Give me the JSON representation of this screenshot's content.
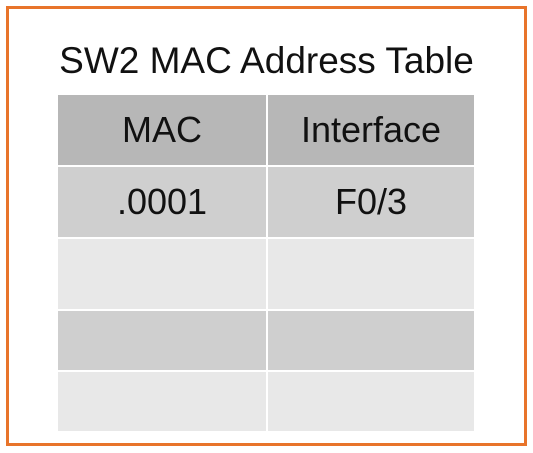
{
  "title": "SW2 MAC Address Table",
  "table": {
    "headers": [
      "MAC",
      "Interface"
    ],
    "rows": [
      [
        ".0001",
        "F0/3"
      ],
      [
        "",
        ""
      ],
      [
        "",
        ""
      ],
      [
        "",
        ""
      ]
    ]
  },
  "colors": {
    "border": "#e8742a",
    "header_fill": "#b7b7b7",
    "row_dark": "#cfcfcf",
    "row_light": "#e8e8e8"
  }
}
